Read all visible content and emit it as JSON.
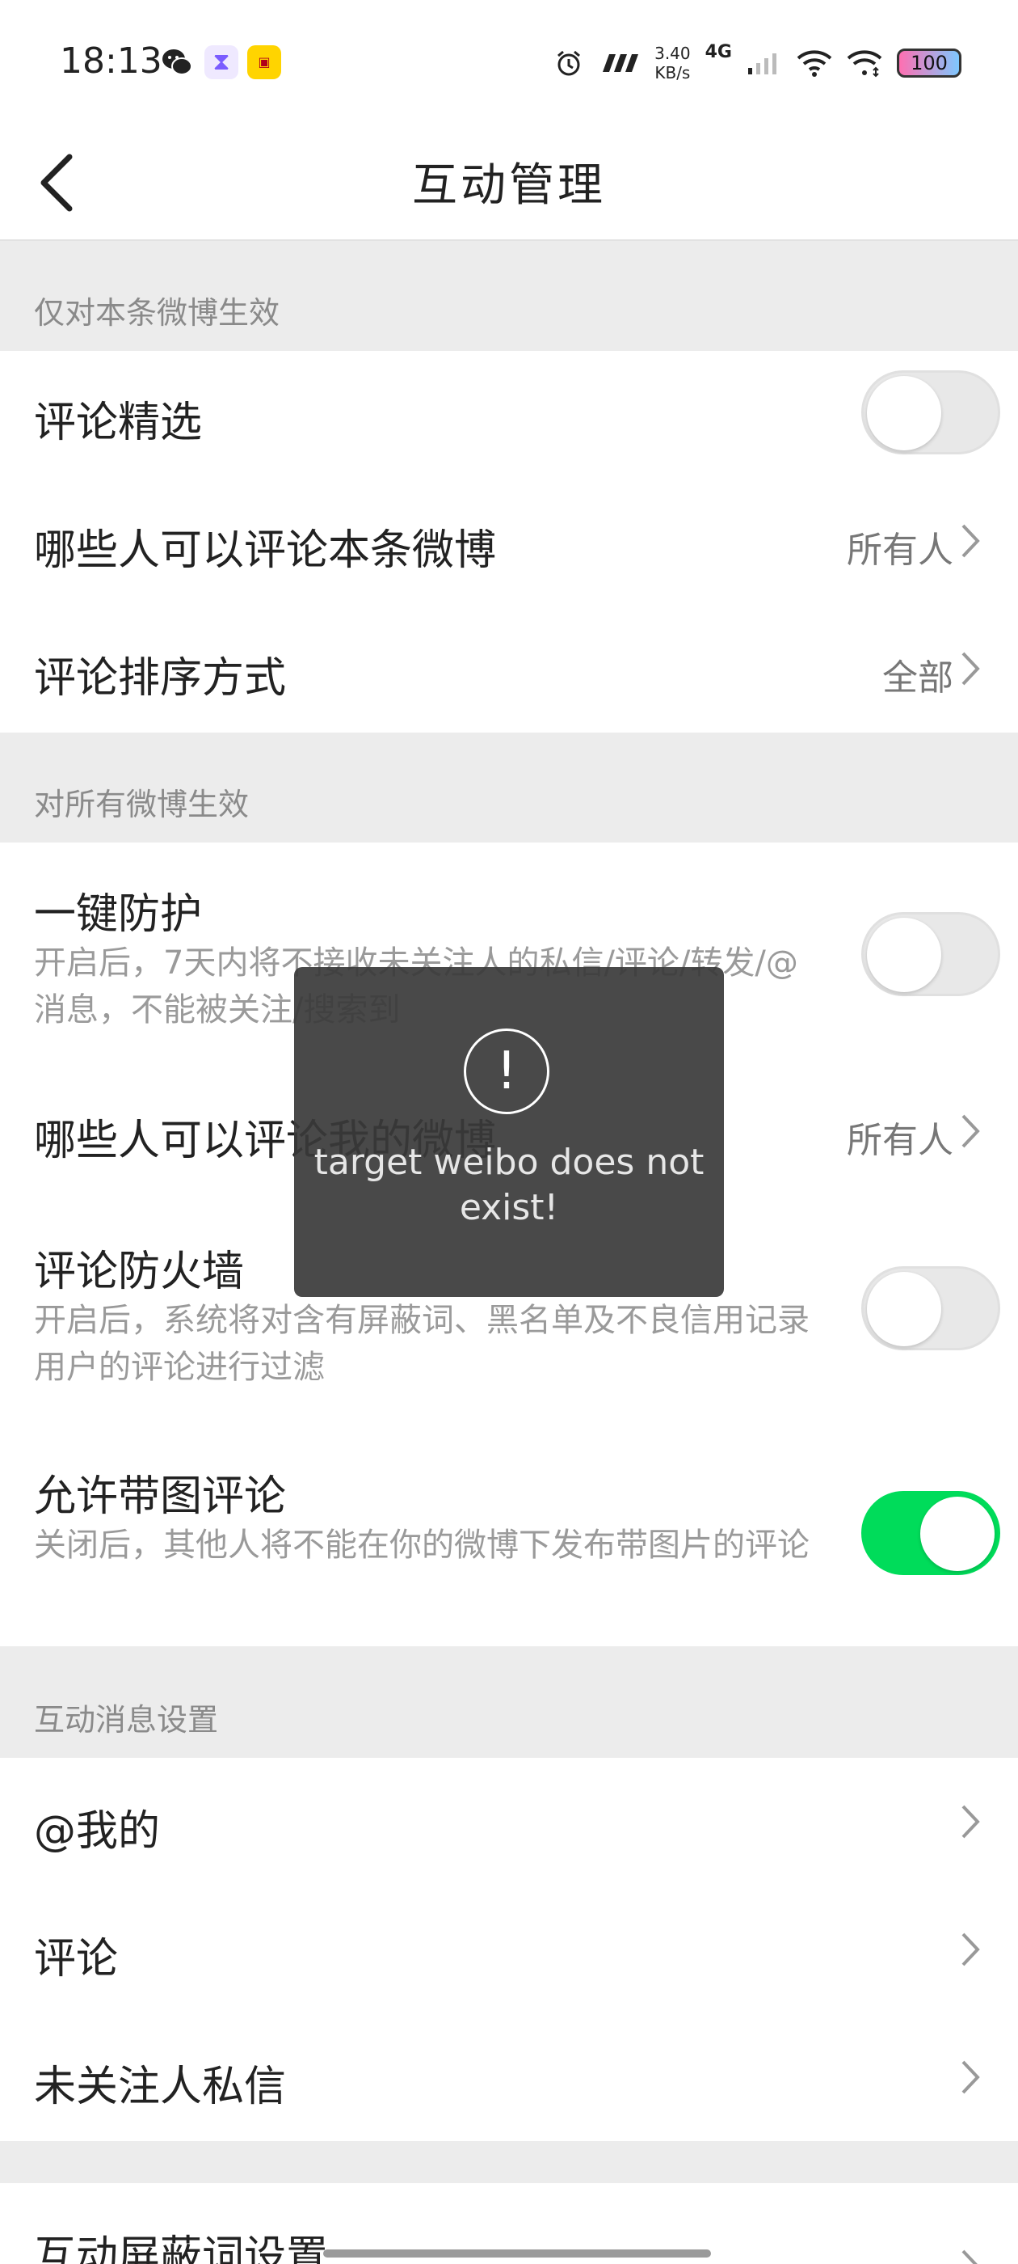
{
  "status_bar": {
    "time": "18:13",
    "apps": [
      "wechat-icon",
      "timer-icon",
      "ticket-icon"
    ],
    "speed_value": "3.40",
    "speed_unit": "KB/s",
    "network": "4G",
    "battery": "100"
  },
  "header": {
    "title": "互动管理"
  },
  "sections": {
    "this_post": "仅对本条微博生效",
    "all_posts": "对所有微博生效",
    "interaction_msgs": "互动消息设置"
  },
  "rows": {
    "comment_select": {
      "title": "评论精选",
      "enabled": false
    },
    "who_comment_this": {
      "title": "哪些人可以评论本条微博",
      "value": "所有人"
    },
    "comment_sort": {
      "title": "评论排序方式",
      "value": "全部"
    },
    "one_key_protect": {
      "title": "一键防护",
      "desc": "开启后，7天内将不接收未关注人的私信/评论/转发/@消息，不能被关注/搜索到",
      "enabled": false
    },
    "who_comment_mine": {
      "title": "哪些人可以评论我的微博",
      "value": "所有人"
    },
    "comment_firewall": {
      "title": "评论防火墙",
      "desc": "开启后，系统将对含有屏蔽词、黑名单及不良信用记录用户的评论进行过滤",
      "enabled": false
    },
    "allow_image_comment": {
      "title": "允许带图评论",
      "desc": "关闭后，其他人将不能在你的微博下发布带图片的评论",
      "enabled": true
    },
    "at_me": {
      "title": "@我的"
    },
    "comments": {
      "title": "评论"
    },
    "stranger_dm": {
      "title": "未关注人私信"
    },
    "block_words": {
      "title": "互动屏蔽词设置"
    }
  },
  "toast": {
    "message": "target weibo does not exist!"
  },
  "colors": {
    "toggle_on": "#00dc5a",
    "toggle_off": "#e8e8e8",
    "background": "#ececec"
  }
}
